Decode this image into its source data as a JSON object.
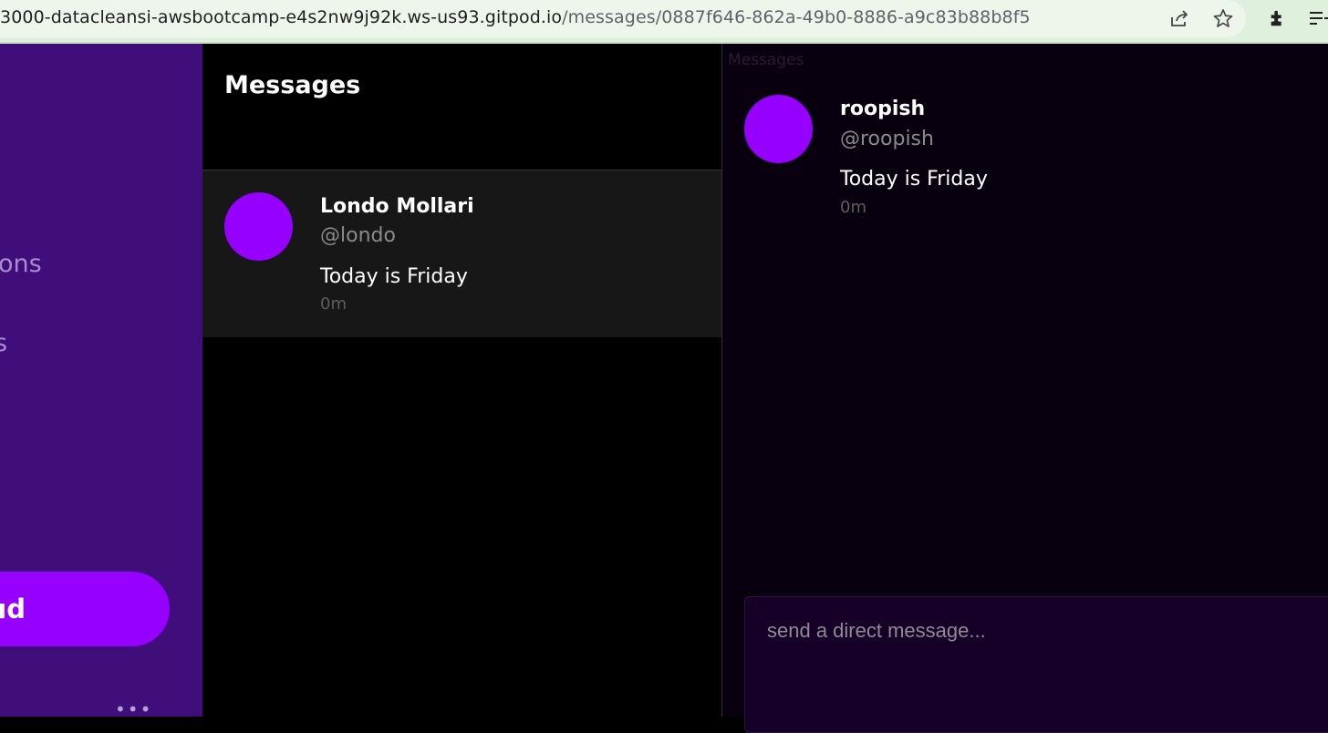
{
  "browser": {
    "url_host": "3000-datacleansi-awsbootcamp-e4s2nw9j92k.ws-us93.gitpod.io",
    "url_path": "/messages/0887f646-862a-49b0-8886-a9c83b88b8f5",
    "icons": [
      "share-icon",
      "star-icon",
      "extensions-icon",
      "reading-list-icon"
    ]
  },
  "sidebar": {
    "partial_items": [
      "ons",
      "s"
    ],
    "crud_label": "ud",
    "more_label": "•••"
  },
  "middle": {
    "title": "Messages",
    "groups": [
      {
        "name": "Londo Mollari",
        "handle": "@londo",
        "message": "Today is Friday",
        "time": "0m"
      }
    ]
  },
  "right": {
    "ghost_label": "Messages",
    "message": {
      "name": "roopish",
      "handle": "@roopish",
      "text": "Today is Friday",
      "time": "0m"
    },
    "composer_placeholder": "send a direct message..."
  },
  "colors": {
    "sidebar_bg": "#400e7b",
    "accent": "#9500ff",
    "composer_bg": "#170028"
  }
}
